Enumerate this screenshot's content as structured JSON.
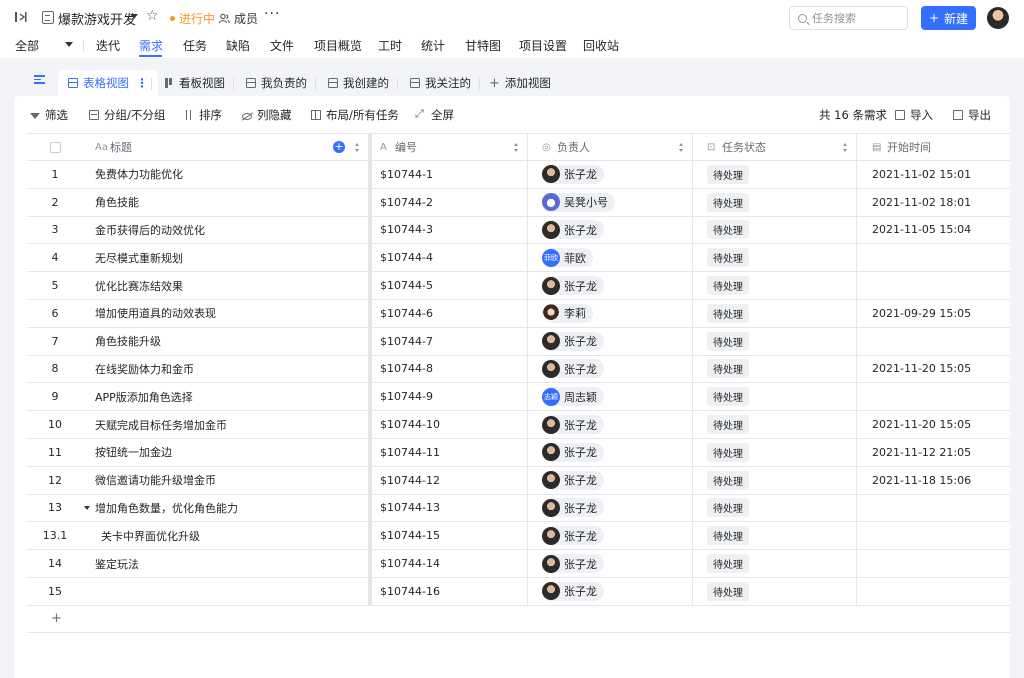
{
  "header": {
    "project_title": "爆款游戏开发",
    "status": "进行中",
    "members_label": "成员",
    "search_placeholder": "任务搜索",
    "new_button": "新建"
  },
  "nav": {
    "scope": "全部",
    "items": [
      {
        "label": "迭代"
      },
      {
        "label": "需求",
        "active": true
      },
      {
        "label": "任务"
      },
      {
        "label": "缺陷"
      },
      {
        "label": "文件"
      },
      {
        "label": "项目概览"
      },
      {
        "label": "工时"
      },
      {
        "label": "统计"
      },
      {
        "label": "甘特图"
      },
      {
        "label": "项目设置"
      },
      {
        "label": "回收站"
      }
    ]
  },
  "views": {
    "tabs": [
      "表格视图",
      "看板视图",
      "我负责的",
      "我创建的",
      "我关注的"
    ],
    "add_view": "添加视图"
  },
  "toolbar": {
    "filter": "筛选",
    "group": "分组/不分组",
    "sort": "排序",
    "columns": "列隐藏",
    "layout": "布局/所有任务",
    "fullscreen": "全屏",
    "count": "共 16 条需求",
    "import": "导入",
    "export": "导出"
  },
  "table": {
    "columns": {
      "title": "标题",
      "number": "编号",
      "owner": "负责人",
      "status": "任务状态",
      "start": "开始时间"
    },
    "rows": [
      {
        "idx": "1",
        "title": "免费体力功能优化",
        "num": "$10744-1",
        "owner": "张子龙",
        "av": "dark",
        "status": "待处理",
        "start": "2021-11-02 15:01"
      },
      {
        "idx": "2",
        "title": "角色技能",
        "num": "$10744-2",
        "owner": "吴凳小号",
        "av": "cartoon",
        "status": "待处理",
        "start": "2021-11-02 18:01"
      },
      {
        "idx": "3",
        "title": "金币获得后的动效优化",
        "num": "$10744-3",
        "owner": "张子龙",
        "av": "dark",
        "status": "待处理",
        "start": "2021-11-05 15:04"
      },
      {
        "idx": "4",
        "title": "无尽模式重新规划",
        "num": "$10744-4",
        "owner": "菲欧",
        "av": "blue",
        "avtext": "菲欧",
        "status": "待处理",
        "start": ""
      },
      {
        "idx": "5",
        "title": "优化比赛冻结效果",
        "num": "$10744-5",
        "owner": "张子龙",
        "av": "dark",
        "status": "待处理",
        "start": ""
      },
      {
        "idx": "6",
        "title": "增加使用道具的动效表现",
        "num": "$10744-6",
        "owner": "李莉",
        "av": "girl",
        "status": "待处理",
        "start": "2021-09-29 15:05"
      },
      {
        "idx": "7",
        "title": "角色技能升级",
        "num": "$10744-7",
        "owner": "张子龙",
        "av": "dark",
        "status": "待处理",
        "start": ""
      },
      {
        "idx": "8",
        "title": "在线奖励体力和金币",
        "num": "$10744-8",
        "owner": "张子龙",
        "av": "dark",
        "status": "待处理",
        "start": "2021-11-20 15:05"
      },
      {
        "idx": "9",
        "title": "APP版添加角色选择",
        "num": "$10744-9",
        "owner": "周志颖",
        "av": "blue",
        "avtext": "志颖",
        "status": "待处理",
        "start": ""
      },
      {
        "idx": "10",
        "title": "天赋完成目标任务增加金币",
        "num": "$10744-10",
        "owner": "张子龙",
        "av": "dark",
        "status": "待处理",
        "start": "2021-11-20 15:05"
      },
      {
        "idx": "11",
        "title": "按钮统一加金边",
        "num": "$10744-11",
        "owner": "张子龙",
        "av": "dark",
        "status": "待处理",
        "start": "2021-11-12 21:05"
      },
      {
        "idx": "12",
        "title": "微信邀请功能升级增金币",
        "num": "$10744-12",
        "owner": "张子龙",
        "av": "dark",
        "status": "待处理",
        "start": "2021-11-18 15:06"
      },
      {
        "idx": "13",
        "title": "增加角色数量，优化角色能力",
        "num": "$10744-13",
        "owner": "张子龙",
        "av": "dark",
        "status": "待处理",
        "start": "",
        "expand": true
      },
      {
        "idx": "13.1",
        "title": "关卡中界面优化升级",
        "num": "$10744-15",
        "owner": "张子龙",
        "av": "dark",
        "status": "待处理",
        "start": "",
        "child": true
      },
      {
        "idx": "14",
        "title": "鉴定玩法",
        "num": "$10744-14",
        "owner": "张子龙",
        "av": "dark",
        "status": "待处理",
        "start": ""
      },
      {
        "idx": "15",
        "title": "",
        "num": "$10744-16",
        "owner": "张子龙",
        "av": "dark",
        "status": "待处理",
        "start": ""
      }
    ],
    "add_row": "+"
  }
}
